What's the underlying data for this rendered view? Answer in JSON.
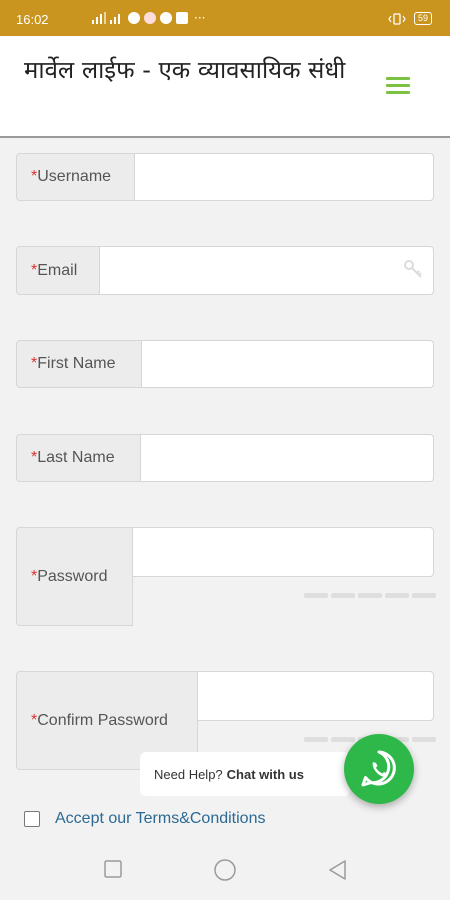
{
  "status_bar": {
    "time": "16:02",
    "dots": "···",
    "battery": "59"
  },
  "header": {
    "title": "मार्वेल लाईफ - एक व्यावसायिक संधी"
  },
  "form": {
    "required_mark": "*",
    "fields": [
      {
        "label": "Username",
        "value": ""
      },
      {
        "label": "Email",
        "value": ""
      },
      {
        "label": "First Name",
        "value": ""
      },
      {
        "label": "Last Name",
        "value": ""
      },
      {
        "label": "Password",
        "value": ""
      },
      {
        "label": "Confirm Password",
        "value": ""
      }
    ]
  },
  "terms": {
    "label": "Accept our Terms&Conditions",
    "checked": false
  },
  "chat": {
    "prompt": "Need Help?",
    "action": "Chat with us"
  },
  "colors": {
    "status_bar": "#c9951f",
    "accent_green": "#7cc242",
    "whatsapp_green": "#2fb84a",
    "link_blue": "#2b6a94",
    "required_red": "#d33333"
  },
  "icons": {
    "menu": "hamburger-menu-icon",
    "chat": "whatsapp-icon",
    "nav_recent": "square-icon",
    "nav_home": "circle-icon",
    "nav_back": "triangle-back-icon"
  }
}
